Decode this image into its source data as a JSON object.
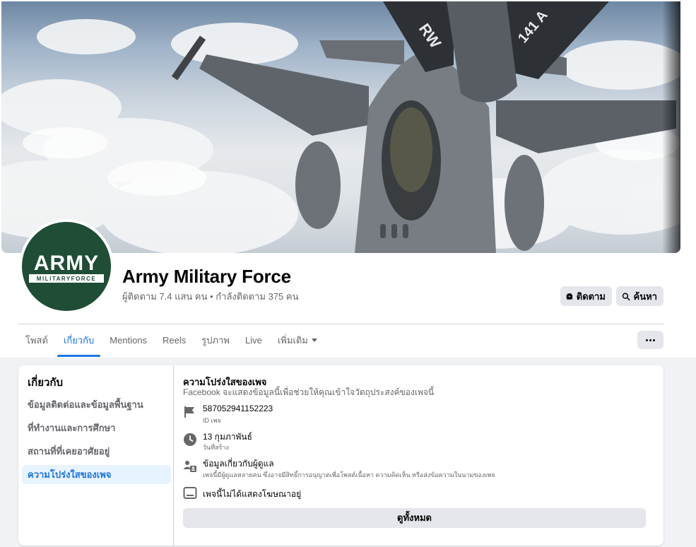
{
  "page": {
    "name": "Army Military Force",
    "stats": "ผู้ติดตาม 7.4 แสน คน • กำลังติดตาม 375 คน",
    "avatar_text": "ARMY",
    "avatar_subtext": "MILITARYFORCE"
  },
  "actions": {
    "follow_label": "ติดตาม",
    "search_label": "ค้นหา"
  },
  "tabs": [
    {
      "label": "โพสต์"
    },
    {
      "label": "เกี่ยวกับ",
      "active": true
    },
    {
      "label": "Mentions"
    },
    {
      "label": "Reels"
    },
    {
      "label": "รูปภาพ"
    },
    {
      "label": "Live"
    },
    {
      "label": "เพิ่มเติม"
    }
  ],
  "about": {
    "title": "เกี่ยวกับ",
    "items": [
      {
        "label": "ข้อมูลติดต่อและข้อมูลพื้นฐาน"
      },
      {
        "label": "ที่ทำงานและการศึกษา"
      },
      {
        "label": "สถานที่ที่เคยอาศัยอยู่"
      },
      {
        "label": "ความโปร่งใสของเพจ",
        "active": true
      }
    ]
  },
  "transparency": {
    "title": "ความโปร่งใสของเพจ",
    "subtitle": "Facebook จะแสดงข้อมูลนี้เพื่อช่วยให้คุณเข้าใจวัตถุประสงค์ของเพจนี้",
    "page_id": {
      "value": "587052941152223",
      "label": "ID เพจ",
      "icon": "flag-icon"
    },
    "created": {
      "value": "13 กุมภาพันธ์",
      "label": "วันที่สร้าง",
      "icon": "clock-icon"
    },
    "managers": {
      "value": "ข้อมูลเกี่ยวกับผู้ดูแล",
      "label": "เพจนี้มีผู้ดูแลหลายคน ซึ่งอาจมีสิทธิ์การอนุญาตเพื่อโพสต์เนื้อหา ความคิดเห็น หรือส่งข้อความในนามของเพจ",
      "icon": "people-icon"
    },
    "ads": {
      "value": "เพจนี้ไม่ได้แสดงโฆษณาอยู่",
      "icon": "screen-icon"
    },
    "see_all_label": "ดูทั้งหมด"
  },
  "colors": {
    "accent": "#1b74e4",
    "avatar_bg": "#1f4d36",
    "button_bg": "#e4e6eb"
  }
}
